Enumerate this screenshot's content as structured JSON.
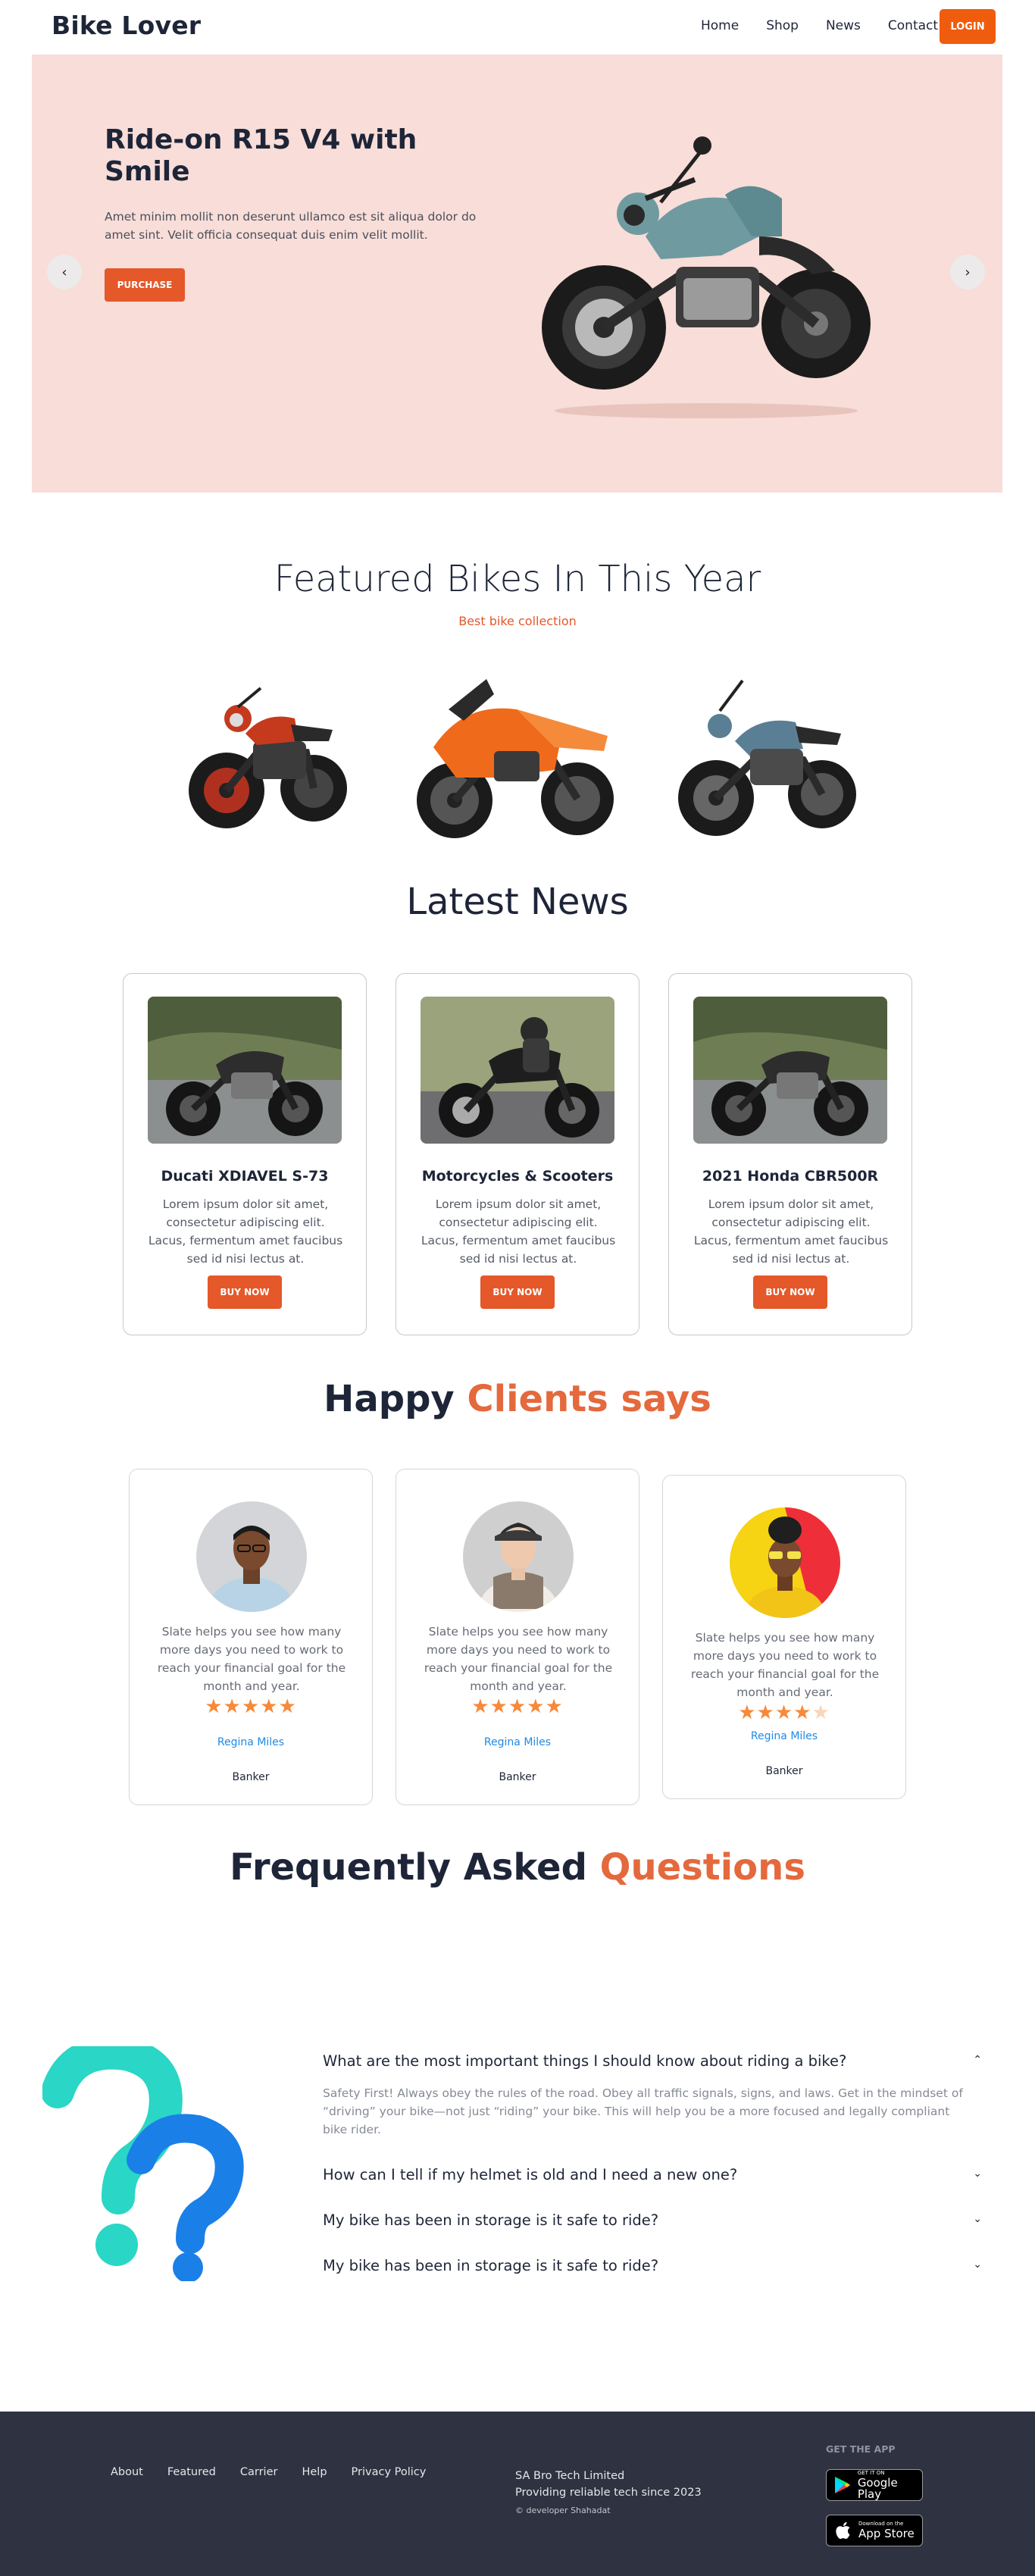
{
  "nav": {
    "brand": "Bike Lover",
    "links": [
      "Home",
      "Shop",
      "News",
      "Contact"
    ],
    "login": "LOGIN"
  },
  "hero": {
    "title": "Ride-on R15 V4 with Smile",
    "text": "Amet minim mollit non deserunt ullamco est sit aliqua dolor do amet sint. Velit officia consequat duis enim velit mollit.",
    "button": "PURCHASE",
    "prev_arrow": "‹",
    "next_arrow": "›"
  },
  "featured": {
    "title": "Featured Bikes In This Year",
    "subtitle": "Best bike collection"
  },
  "news": {
    "title": "Latest News",
    "cards": [
      {
        "name": "Ducati XDIAVEL S-73",
        "text": "Lorem ipsum dolor sit amet, consectetur adipiscing elit. Lacus, fermentum amet faucibus sed id nisi lectus at.",
        "button": "BUY NOW"
      },
      {
        "name": "Motorcycles & Scooters",
        "text": "Lorem ipsum dolor sit amet, consectetur adipiscing elit. Lacus, fermentum amet faucibus sed id nisi lectus at.",
        "button": "BUY NOW"
      },
      {
        "name": "2021 Honda CBR500R",
        "text": "Lorem ipsum dolor sit amet, consectetur adipiscing elit. Lacus, fermentum amet faucibus sed id nisi lectus at.",
        "button": "BUY NOW"
      }
    ]
  },
  "clients": {
    "title_main": "Happy ",
    "title_accent": "Clients says",
    "cards": [
      {
        "quote": "Slate helps you see how many more days you need to work to reach your financial goal for the month and year.",
        "rating": 5,
        "name": "Regina Miles",
        "role": "Banker"
      },
      {
        "quote": "Slate helps you see how many more days you need to work to reach your financial goal for the month and year.",
        "rating": 5,
        "name": "Regina Miles",
        "role": "Banker"
      },
      {
        "quote": "Slate helps you see how many more days you need to work to reach your financial goal for the month and year.",
        "rating": 4,
        "name": "Regina Miles",
        "role": "Banker"
      }
    ]
  },
  "faq": {
    "title_main": "Frequently Asked ",
    "title_accent": "Questions",
    "items": [
      {
        "q": "What are the most important things I should know about riding a bike?",
        "open": true,
        "a": "Safety First! Always obey the rules of the road. Obey all traffic signals, signs, and laws. Get in the mindset of “driving” your bike—not just “riding” your bike. This will help you be a more focused and legally compliant bike rider."
      },
      {
        "q": "How can I tell if my helmet is old and I need a new one?",
        "open": false
      },
      {
        "q": "My bike has been in storage is it safe to ride?",
        "open": false
      },
      {
        "q": "My bike has been in storage is it safe to ride?",
        "open": false
      }
    ]
  },
  "footer": {
    "links": [
      "About",
      "Featured",
      "Carrier",
      "Help",
      "Privacy Policy"
    ],
    "company_line1": "SA Bro Tech Limited",
    "company_line2": "Providing reliable tech since 2023",
    "developer": "© developer Shahadat",
    "get_app": "GET THE APP",
    "google_small": "GET IT ON",
    "google_big": "Google Play",
    "apple_small": "Download on the",
    "apple_big": "App Store"
  },
  "colors": {
    "accent": "#e4582a",
    "login": "#f05c0e",
    "hero_bg": "#f8ddd8",
    "footer_bg": "#2e3241",
    "star": "#f7893a",
    "client_name": "#1f8ae6"
  }
}
